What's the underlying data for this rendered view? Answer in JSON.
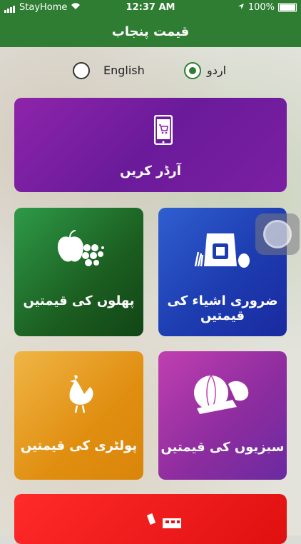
{
  "status_bar": {
    "carrier": "StayHome",
    "time": "12:37 AM",
    "battery": "100%"
  },
  "header": {
    "title": "قیمت پنجاب"
  },
  "language": {
    "english_label": "English",
    "urdu_label": "اردو",
    "selected": "urdu"
  },
  "cards": {
    "order": {
      "label": "آرڈر کریں"
    },
    "fruits": {
      "label": "پھلوں کی قیمتیں"
    },
    "essentials": {
      "label": "ضروری اشیاء کی قیمتیں"
    },
    "poultry": {
      "label": "پولٹری کی قیمتیں"
    },
    "vegetables": {
      "label": "سبزیوں کی قیمتیں"
    }
  },
  "colors": {
    "header": "#2e7d32",
    "order": "#7b1fa2",
    "fruits": "#1b5e20",
    "essentials": "#1d3cb0",
    "poultry": "#e08e10",
    "vegetables": "#8e2d9f",
    "bottom": "#e01010"
  }
}
